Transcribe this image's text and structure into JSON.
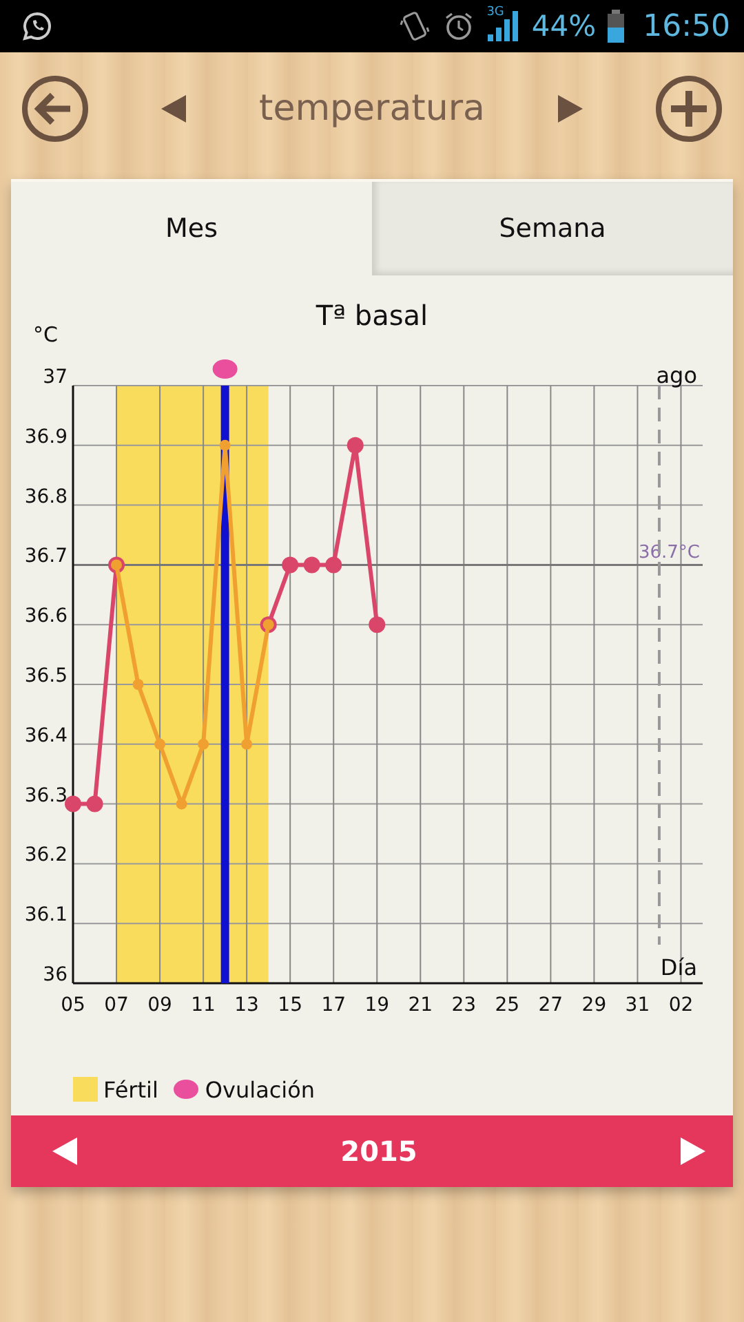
{
  "status_bar": {
    "network": "3G",
    "battery": "44%",
    "time": "16:50"
  },
  "toolbar": {
    "title": "temperatura"
  },
  "tabs": [
    {
      "label": "Mes",
      "selected": true
    },
    {
      "label": "Semana",
      "selected": false
    }
  ],
  "chart": {
    "chart_data": {
      "type": "line",
      "title": "Tª basal",
      "ylabel": "°C",
      "x": [
        "2015-07-05",
        "2015-07-06",
        "2015-07-07",
        "2015-07-08",
        "2015-07-09",
        "2015-07-10",
        "2015-07-11",
        "2015-07-12",
        "2015-07-13",
        "2015-07-14",
        "2015-07-15",
        "2015-07-16",
        "2015-07-17",
        "2015-07-18",
        "2015-07-19"
      ],
      "series": [
        {
          "color": "#d9466a",
          "marker": "circle",
          "values": [
            36.3,
            36.3,
            36.7,
            null,
            null,
            null,
            null,
            null,
            null,
            36.6,
            36.7,
            36.7,
            36.7,
            36.9,
            36.6
          ]
        },
        {
          "color": "#f0a030",
          "marker": "circle",
          "values": [
            null,
            null,
            36.7,
            36.5,
            36.4,
            36.3,
            36.4,
            36.9,
            36.4,
            36.6,
            null,
            null,
            null,
            null,
            null
          ]
        }
      ],
      "grid": true,
      "xlim": [
        "2015-07-05",
        "2015-08-03"
      ],
      "ylim": [
        36,
        37
      ],
      "xticks": [
        {
          "value": "2015-07-05",
          "label": "05"
        },
        {
          "value": "2015-07-07",
          "label": "07"
        },
        {
          "value": "2015-07-09",
          "label": "09"
        },
        {
          "value": "2015-07-11",
          "label": "11"
        },
        {
          "value": "2015-07-13",
          "label": "13"
        },
        {
          "value": "2015-07-15",
          "label": "15"
        },
        {
          "value": "2015-07-17",
          "label": "17"
        },
        {
          "value": "2015-07-19",
          "label": "19"
        },
        {
          "value": "2015-07-21",
          "label": "21"
        },
        {
          "value": "2015-07-23",
          "label": "23"
        },
        {
          "value": "2015-07-25",
          "label": "25"
        },
        {
          "value": "2015-07-27",
          "label": "27"
        },
        {
          "value": "2015-07-29",
          "label": "29"
        },
        {
          "value": "2015-07-31",
          "label": "31"
        },
        {
          "value": "2015-08-02",
          "label": "02"
        }
      ],
      "yticks": [
        {
          "value": 36,
          "label": "36"
        },
        {
          "value": 36.1,
          "label": "36.1"
        },
        {
          "value": 36.2,
          "label": "36.2"
        },
        {
          "value": 36.3,
          "label": "36.3"
        },
        {
          "value": 36.4,
          "label": "36.4"
        },
        {
          "value": 36.5,
          "label": "36.5"
        },
        {
          "value": 36.6,
          "label": "36.6"
        },
        {
          "value": 36.7,
          "label": "36.7"
        },
        {
          "value": 36.8,
          "label": "36.8"
        },
        {
          "value": 36.9,
          "label": "36.9"
        },
        {
          "value": 37,
          "label": "37"
        }
      ],
      "bands": [
        {
          "axis": "x",
          "from": "2015-07-07",
          "to": "2015-07-14",
          "color": "#f9dc5c"
        }
      ],
      "ref_lines": [
        {
          "axis": "y",
          "value": 36.7,
          "label": "36.7°C",
          "color": "#777777"
        },
        {
          "axis": "x",
          "value": "2015-07-12",
          "color": "#1010d0"
        },
        {
          "axis": "x",
          "value": "2015-08-01",
          "color": "#999999"
        }
      ],
      "annotations": [
        "ago",
        "Día"
      ]
    },
    "legend": [
      {
        "kind": "fertile",
        "label": "Fértil"
      },
      {
        "kind": "ovulation",
        "label": "Ovulación"
      }
    ]
  },
  "footer": {
    "year": "2015"
  }
}
